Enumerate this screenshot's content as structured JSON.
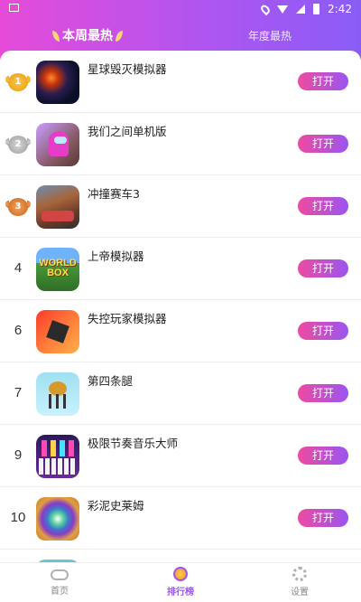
{
  "statusbar": {
    "time": "2:42"
  },
  "tabs": {
    "weekly": "本周最热",
    "yearly": "年度最热"
  },
  "list": [
    {
      "rank": "1",
      "rank_style": "gold",
      "name": "星球毁灭模拟器",
      "button": "打开",
      "icon": "planet-explosion-icon"
    },
    {
      "rank": "2",
      "rank_style": "silver",
      "name": "我们之间单机版",
      "button": "打开",
      "icon": "crewmate-icon"
    },
    {
      "rank": "3",
      "rank_style": "bronze",
      "name": "冲撞赛车3",
      "button": "打开",
      "icon": "race-car-icon"
    },
    {
      "rank": "4",
      "rank_style": "plain",
      "name": "上帝模拟器",
      "button": "打开",
      "icon": "worldbox-icon"
    },
    {
      "rank": "6",
      "rank_style": "plain",
      "name": "失控玩家模拟器",
      "button": "打开",
      "icon": "crash-box-icon"
    },
    {
      "rank": "7",
      "rank_style": "plain",
      "name": "第四条腿",
      "button": "打开",
      "icon": "bug-legs-icon"
    },
    {
      "rank": "9",
      "rank_style": "plain",
      "name": "极限节奏音乐大师",
      "button": "打开",
      "icon": "piano-icon"
    },
    {
      "rank": "10",
      "rank_style": "plain",
      "name": "彩泥史莱姆",
      "button": "打开",
      "icon": "slime-icon"
    }
  ],
  "bottomnav": {
    "home": "首页",
    "ranking": "排行榜",
    "settings": "设置"
  },
  "colors": {
    "accent_start": "#ee4ba0",
    "accent_end": "#9a55f0",
    "header": "#c150e8"
  }
}
